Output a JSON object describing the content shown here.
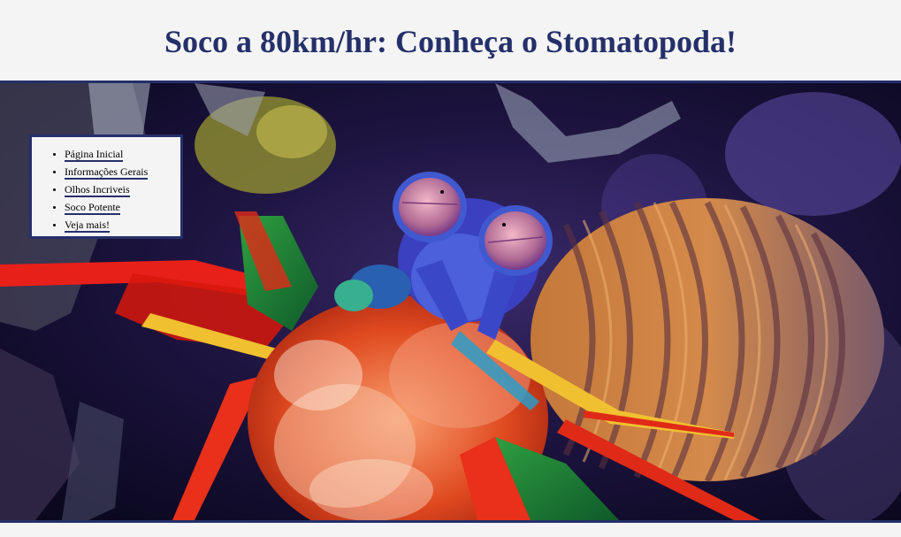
{
  "header": {
    "title": "Soco a 80km/hr: Conheça o Stomatopoda!"
  },
  "nav": {
    "items": [
      {
        "label": "Página Inicial"
      },
      {
        "label": "Informações Gerais"
      },
      {
        "label": "Olhos Incriveis"
      },
      {
        "label": "Soco Potente"
      },
      {
        "label": "Veja mais!"
      }
    ]
  },
  "hero": {
    "image_subject": "mantis shrimp (stomatopoda) photograph",
    "icon": "mantis-shrimp-image"
  },
  "colors": {
    "title": "#25306a",
    "accent_border": "#25306a",
    "background": "#f4f4f4"
  }
}
